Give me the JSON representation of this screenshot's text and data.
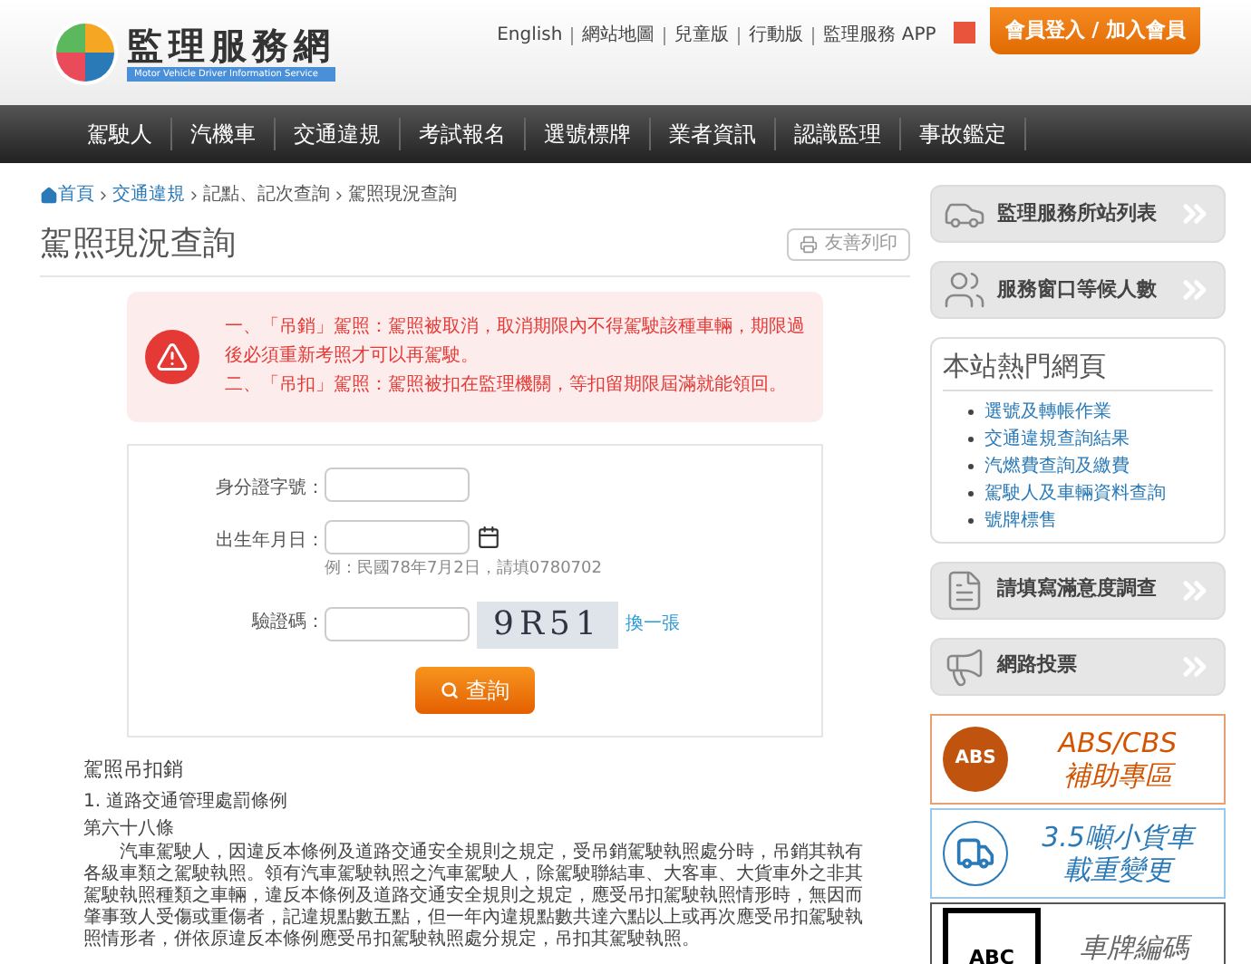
{
  "header": {
    "logo_title": "監理服務網",
    "logo_subtitle": "Motor Vehicle Driver Information Service",
    "top_links": [
      "English",
      "網站地圖",
      "兒童版",
      "行動版",
      "監理服務 APP"
    ],
    "login_button": "會員登入 / 加入會員"
  },
  "nav": {
    "items": [
      "駕駛人",
      "汽機車",
      "交通違規",
      "考試報名",
      "選號標牌",
      "業者資訊",
      "認識監理",
      "事故鑑定"
    ]
  },
  "breadcrumb": [
    {
      "label": "首頁",
      "link": true
    },
    {
      "label": "交通違規",
      "link": true
    },
    {
      "label": "記點、記次查詢",
      "link": false
    },
    {
      "label": "駕照現況查詢",
      "link": false
    }
  ],
  "page_title": "駕照現況查詢",
  "print_button": "友善列印",
  "alert": {
    "lines": [
      "一、「吊銷」駕照：駕照被取消，取消期限內不得駕駛該種車輛，期限過後必須重新考照才可以再駕駛。",
      "二、「吊扣」駕照：駕照被扣在監理機關，等扣留期限屆滿就能領回。"
    ]
  },
  "form": {
    "fields": [
      {
        "kind": "text",
        "label": "身分證字號："
      },
      {
        "kind": "date",
        "label": "出生年月日：",
        "hint": "例：民國78年7月2日，請填0780702"
      },
      {
        "kind": "captcha",
        "label": "驗證碼：",
        "captcha": "9R51",
        "refresh": "換一張"
      }
    ],
    "submit": "查詢"
  },
  "article": {
    "title": "駕照吊扣銷",
    "law": "1. 道路交通管理處罰條例",
    "clause": "第六十八條",
    "body": "汽車駕駛人，因違反本條例及道路交通安全規則之規定，受吊銷駕駛執照處分時，吊銷其執有各級車類之駕駛執照。領有汽車駕駛執照之汽車駕駛人，除駕駛聯結車、大客車、大貨車外之非其駕駛執照種類之車輛，違反本條例及道路交通安全規則之規定，應受吊扣駕駛執照情形時，無因而肇事致人受傷或重傷者，記違規點數五點，但一年內違規點數共達六點以上或再次應受吊扣駕駛執照情形者，併依原違反本條例應受吊扣駕駛執照處分規定，吊扣其駕駛執照。"
  },
  "sidebar": {
    "top_buttons": [
      {
        "kind": "car",
        "label": "監理服務所站列表"
      },
      {
        "kind": "people",
        "label": "服務窗口等候人數"
      }
    ],
    "hot_pages": {
      "title": "本站熱門網頁",
      "links": [
        "選號及轉帳作業",
        "交通違規查詢結果",
        "汽燃費查詢及繳費",
        "駕駛人及車輛資料查詢",
        "號牌標售"
      ]
    },
    "bottom_buttons": [
      {
        "kind": "survey",
        "label": "請填寫滿意度調查"
      },
      {
        "kind": "vote",
        "label": "網路投票"
      }
    ],
    "banners": [
      {
        "kind": "abs",
        "badge": "ABS",
        "line1": "ABS/CBS",
        "line2": "補助專區"
      },
      {
        "kind": "truck",
        "line1": "3.5噸小貨車",
        "line2": "載重變更"
      },
      {
        "kind": "plate",
        "badge": "ABC",
        "line1": "車牌編碼"
      }
    ]
  }
}
